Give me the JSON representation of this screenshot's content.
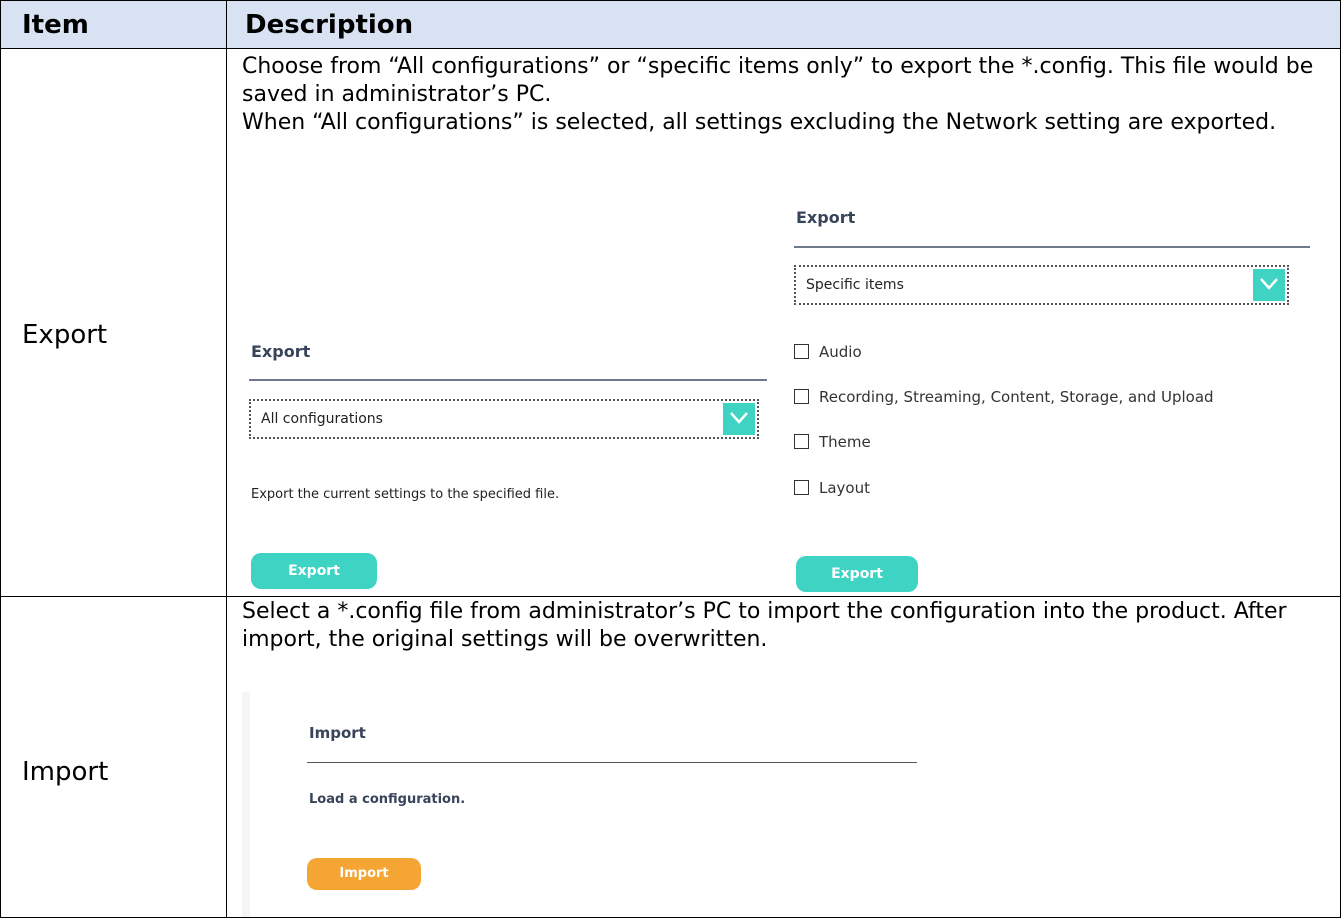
{
  "table": {
    "headers": {
      "item": "Item",
      "description": "Description"
    },
    "rows": [
      {
        "item": "Export",
        "description": [
          "Choose from “All configurations” or “specific items only” to export the *.config. This file would be saved in administrator’s PC.",
          "When “All configurations” is selected, all settings excluding the Network setting are exported."
        ]
      },
      {
        "item": "Import",
        "description": [
          "Select a *.config file from administrator’s PC to import the configuration into the product. After import, the original settings will be overwritten."
        ]
      }
    ]
  },
  "export_all": {
    "title": "Export",
    "select_value": "All configurations",
    "note": "Export the current settings to the specified file.",
    "button_label": "Export"
  },
  "export_specific": {
    "title": "Export",
    "select_value": "Specific items",
    "checkboxes": [
      {
        "label": "Audio",
        "checked": false
      },
      {
        "label": "Recording, Streaming, Content, Storage, and Upload",
        "checked": false
      },
      {
        "label": "Theme",
        "checked": false
      },
      {
        "label": "Layout",
        "checked": false
      }
    ],
    "button_label": "Export"
  },
  "import": {
    "title": "Import",
    "note": "Load a configuration.",
    "button_label": "Import"
  },
  "colors": {
    "header_bg": "#d9e2f3",
    "accent_teal": "#3fd3c4",
    "accent_orange": "#f4a533"
  },
  "icons": {
    "dropdown": "chevron-down-icon",
    "checkbox": "checkbox-unchecked-icon"
  }
}
